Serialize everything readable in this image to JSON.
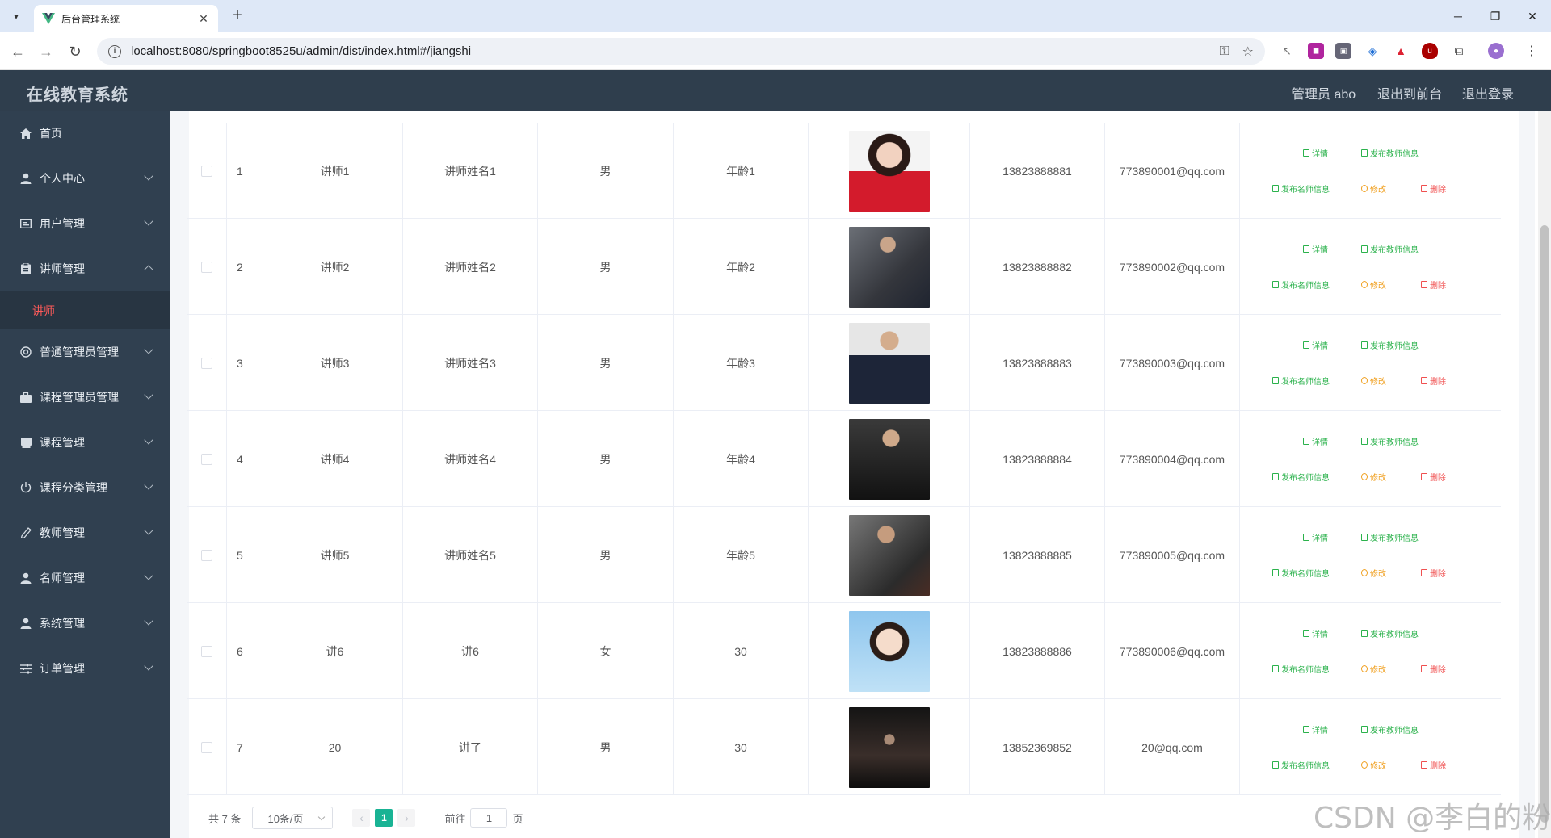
{
  "browser": {
    "tab_title": "后台管理系统",
    "url": "localhost:8080/springboot8525u/admin/dist/index.html#/jiangshi"
  },
  "header": {
    "app_title": "在线教育系统",
    "user_label": "管理员 abo",
    "exit_front": "退出到前台",
    "logout": "退出登录"
  },
  "sidebar": {
    "items": [
      {
        "label": "首页",
        "icon": "home-icon"
      },
      {
        "label": "个人中心",
        "icon": "user-icon"
      },
      {
        "label": "用户管理",
        "icon": "id-card-icon"
      },
      {
        "label": "讲师管理",
        "icon": "clipboard-icon",
        "expanded": true
      },
      {
        "label": "普通管理员管理",
        "icon": "settings-icon"
      },
      {
        "label": "课程管理员管理",
        "icon": "briefcase-icon"
      },
      {
        "label": "课程管理",
        "icon": "book-icon"
      },
      {
        "label": "课程分类管理",
        "icon": "power-icon"
      },
      {
        "label": "教师管理",
        "icon": "edit-icon"
      },
      {
        "label": "名师管理",
        "icon": "user-icon"
      },
      {
        "label": "系统管理",
        "icon": "user-icon"
      },
      {
        "label": "订单管理",
        "icon": "sliders-icon"
      }
    ],
    "active_sub": "讲师"
  },
  "table": {
    "actions": {
      "detail": "详情",
      "publish_teacher": "发布教师信息",
      "publish_famous": "发布名师信息",
      "edit": "修改",
      "delete": "删除"
    },
    "rows": [
      {
        "index": "1",
        "account": "讲师1",
        "name": "讲师姓名1",
        "gender": "男",
        "age": "年龄1",
        "phone": "13823888881",
        "email": "773890001@qq.com"
      },
      {
        "index": "2",
        "account": "讲师2",
        "name": "讲师姓名2",
        "gender": "男",
        "age": "年龄2",
        "phone": "13823888882",
        "email": "773890002@qq.com"
      },
      {
        "index": "3",
        "account": "讲师3",
        "name": "讲师姓名3",
        "gender": "男",
        "age": "年龄3",
        "phone": "13823888883",
        "email": "773890003@qq.com"
      },
      {
        "index": "4",
        "account": "讲师4",
        "name": "讲师姓名4",
        "gender": "男",
        "age": "年龄4",
        "phone": "13823888884",
        "email": "773890004@qq.com"
      },
      {
        "index": "5",
        "account": "讲师5",
        "name": "讲师姓名5",
        "gender": "男",
        "age": "年龄5",
        "phone": "13823888885",
        "email": "773890005@qq.com"
      },
      {
        "index": "6",
        "account": "讲6",
        "name": "讲6",
        "gender": "女",
        "age": "30",
        "phone": "13823888886",
        "email": "773890006@qq.com"
      },
      {
        "index": "7",
        "account": "20",
        "name": "讲了",
        "gender": "男",
        "age": "30",
        "phone": "13852369852",
        "email": "20@qq.com"
      }
    ]
  },
  "pagination": {
    "total": "共 7 条",
    "page_size": "10条/页",
    "prev": "‹",
    "current": "1",
    "next": "›",
    "goto_prefix": "前往",
    "goto_value": "1",
    "goto_suffix": "页"
  },
  "watermark": "CSDN @李白的粉"
}
